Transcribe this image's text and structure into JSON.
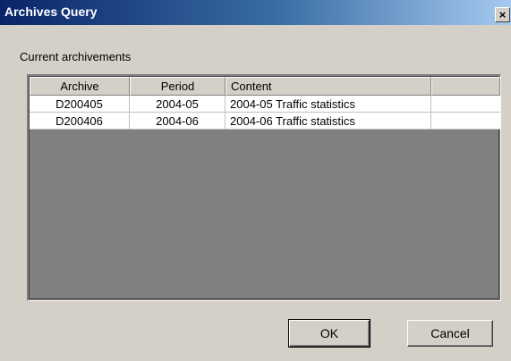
{
  "window": {
    "title": "Archives Query",
    "close_glyph": "×"
  },
  "section": {
    "label": "Current archivements"
  },
  "table": {
    "columns": [
      "Archive",
      "Period",
      "Content"
    ],
    "rows": [
      [
        "D200405",
        "2004-05",
        "2004-05 Traffic statistics"
      ],
      [
        "D200406",
        "2004-06",
        "2004-06 Traffic statistics"
      ]
    ]
  },
  "buttons": {
    "ok_label": "OK",
    "cancel_label": "Cancel"
  },
  "colors": {
    "titlebar_start": "#0a246a",
    "titlebar_end": "#a6caf0",
    "dialog_face": "#d4d0c8",
    "grid_empty": "#808080"
  }
}
